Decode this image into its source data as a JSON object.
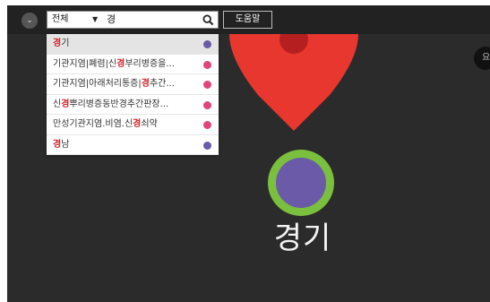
{
  "colors": {
    "pin_red": "#e8372e",
    "ring_green": "#7bbf3e",
    "center_purple": "#6a5aa8",
    "dot_purple": "#6a5aa8",
    "dot_pink": "#e0457a",
    "highlight_red": "#d6252a"
  },
  "topbar": {
    "menu_icon": "chevron-down-icon",
    "category_select": "전체",
    "search_value": "경",
    "search_icon": "search-icon",
    "help_label": "도움말",
    "right_button_label": "요"
  },
  "dropdown": {
    "items": [
      {
        "pre": "",
        "hl": "경",
        "post": "기",
        "dot": "purple"
      },
      {
        "pre": "기관지염|폐렴|신",
        "hl": "경",
        "post": "부리병증을...",
        "dot": "pink"
      },
      {
        "pre": "기관지염|아래처리통증|",
        "hl": "경",
        "post": "추간...",
        "dot": "pink"
      },
      {
        "pre": "신",
        "hl": "경",
        "post": "뿌리병증동반경추간판장...",
        "dot": "pink"
      },
      {
        "pre": "만성기관지염.비염.신",
        "hl": "경",
        "post": "쇠약",
        "dot": "pink"
      },
      {
        "pre": "",
        "hl": "경",
        "post": "남",
        "dot": "purple"
      }
    ]
  },
  "map": {
    "region_label": "경기"
  }
}
